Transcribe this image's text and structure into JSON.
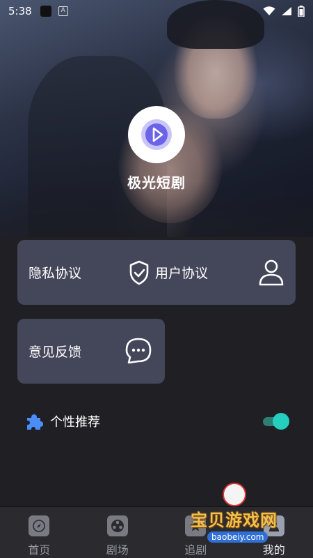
{
  "status_bar": {
    "time": "5:38",
    "a_label": "A"
  },
  "app": {
    "name": "极光短剧"
  },
  "cards": {
    "privacy_label": "隐私协议",
    "user_agreement_label": "用户协议",
    "feedback_label": "意见反馈"
  },
  "recommendation": {
    "label": "个性推荐",
    "enabled": true
  },
  "nav": {
    "items": [
      {
        "label": "首页",
        "icon": "compass-icon"
      },
      {
        "label": "剧场",
        "icon": "film-reel-icon"
      },
      {
        "label": "追剧",
        "icon": "star-icon"
      },
      {
        "label": "我的",
        "icon": "profile-icon"
      }
    ]
  },
  "watermark": {
    "text": "宝贝游戏网",
    "url": "baobeiy.com"
  },
  "colors": {
    "card_bg": "#44475a",
    "toggle_on": "#25cfbf",
    "logo_accent": "#6b63e8"
  }
}
